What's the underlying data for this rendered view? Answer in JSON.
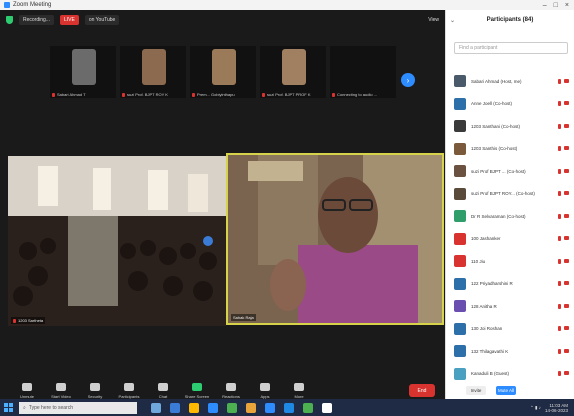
{
  "window": {
    "title": "Zoom Meeting"
  },
  "topbar": {
    "recording_label": "Recording...",
    "live_chip": "LIVE",
    "live_on_label": "on YouTube",
    "view_label": "View"
  },
  "strip": [
    {
      "name": "Sabari Ahmad T",
      "face_color": "#6b6b6b"
    },
    {
      "name": "suzi Prof. BJPT ROY K",
      "face_color": "#8b6a4f"
    },
    {
      "name": "Prem... Gobiyinthapu",
      "face_color": "#9b7a5a"
    },
    {
      "name": "suzi Prof. BJPT PROF K",
      "face_color": "#a08060"
    },
    {
      "name": "Connecting to audio ...",
      "face_color": "#111111"
    }
  ],
  "videos": {
    "left_label": "1203 Sartheta",
    "right_label": "Sahak Raja"
  },
  "controls": [
    {
      "label": "Unmute",
      "icon": "mic-icon"
    },
    {
      "label": "Start Video",
      "icon": "video-icon"
    },
    {
      "label": "Security",
      "icon": "shield-icon"
    },
    {
      "label": "Participants",
      "icon": "participants-icon"
    },
    {
      "label": "Chat",
      "icon": "chat-icon"
    },
    {
      "label": "Share Screen",
      "icon": "share-icon"
    },
    {
      "label": "Reactions",
      "icon": "record-icon"
    },
    {
      "label": "Apps",
      "icon": "apps-icon"
    },
    {
      "label": "More",
      "icon": "more-icon"
    }
  ],
  "end_label": "End",
  "panel": {
    "title": "Participants (84)",
    "search_placeholder": "Find a participant",
    "participants": [
      {
        "name": "Sabari Ahmad (Host, me)",
        "color": "#4a5a6a"
      },
      {
        "name": "Anne Joell (Co-host)",
        "color": "#2d6fa8"
      },
      {
        "name": "1203 Santhani (Co-host)",
        "color": "#3a3a3a"
      },
      {
        "name": "1203 Santhis (Co-host)",
        "color": "#7a5a3a"
      },
      {
        "name": "suzi Prof BJPT ... (Co-host)",
        "color": "#6b5140"
      },
      {
        "name": "suzi Prof BJPT ROY... (Co-host)",
        "color": "#5a4a3a"
      },
      {
        "name": "Dr R Selvaraman (Co-host)",
        "color": "#2f9e6a"
      },
      {
        "name": "100 Jashanker",
        "color": "#d9332f"
      },
      {
        "name": "110 Jiu",
        "color": "#d9332f"
      },
      {
        "name": "122 Priyadharshini R",
        "color": "#2d6fa8"
      },
      {
        "name": "128 Anitha R",
        "color": "#6a4fb0"
      },
      {
        "name": "130 Joi Roshan",
        "color": "#2d6fa8"
      },
      {
        "name": "132 Thilagavathi K",
        "color": "#2d6fa8"
      },
      {
        "name": "Kanaduli B (Guest)",
        "color": "#4aa0c0"
      }
    ],
    "invite_label": "Invite",
    "mute_all_label": "Mute All"
  },
  "taskbar": {
    "search_placeholder": "Type here to search",
    "apps": [
      "#6fa8dc",
      "#3a7bd5",
      "#ffb900",
      "#2d8cff",
      "#4caf50",
      "#e8a33a",
      "#2d8cff",
      "#1e88e5",
      "#4caf50",
      "#ffffff"
    ],
    "time": "11:03 AM",
    "date": "14-06-2023"
  }
}
